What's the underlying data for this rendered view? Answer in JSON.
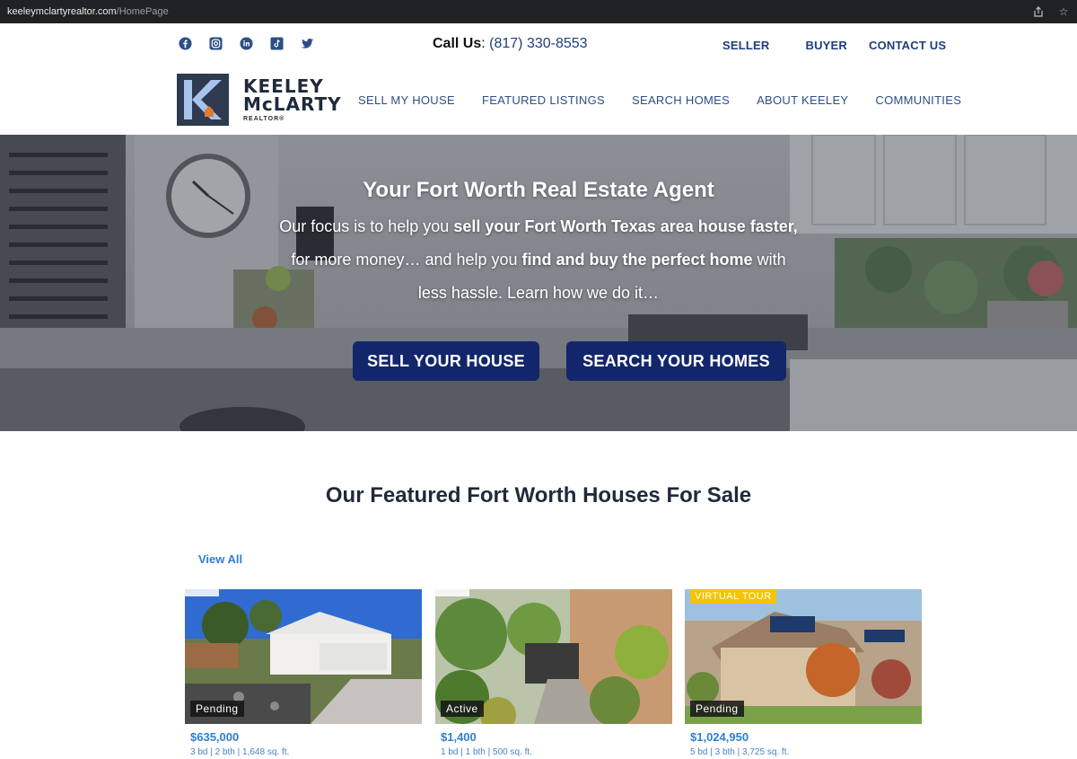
{
  "browser": {
    "domain": "keeleymclartyrealtor.com",
    "path": "/HomePage"
  },
  "topbar": {
    "socials": [
      "facebook-icon",
      "instagram-icon",
      "linkedin-icon",
      "tiktok-icon",
      "twitter-icon"
    ],
    "call_label": "Call Us",
    "call_sep": ":",
    "phone": "(817) 330-8553",
    "links": [
      "SELLER",
      "BUYER",
      "CONTACT US"
    ]
  },
  "logo": {
    "line1": "KEELEY",
    "line2": "McLARTY",
    "line3": "REALTOR®"
  },
  "nav": [
    "SELL MY HOUSE",
    "FEATURED LISTINGS",
    "SEARCH HOMES",
    "ABOUT KEELEY",
    "COMMUNITIES"
  ],
  "hero": {
    "title": "Your Fort Worth Real Estate Agent",
    "p1": "Our focus is to help you ",
    "b1": "sell your Fort Worth Texas area house faster,",
    "p2": " for more money… and help you ",
    "b2": "find and buy the perfect home",
    "p3": " with less hassle. Learn how we do it…",
    "btn_sell": "SELL YOUR HOUSE",
    "btn_search": "SEARCH YOUR HOMES"
  },
  "featured": {
    "title": "Our Featured Fort Worth Houses For Sale",
    "view_all": "View All",
    "listings": [
      {
        "status": "Pending",
        "price": "$635,000",
        "details": "3 bd | 2 bth | 1,648 sq. ft.",
        "tour": ""
      },
      {
        "status": "Active",
        "price": "$1,400",
        "details": "1 bd | 1 bth | 500 sq. ft.",
        "tour": ""
      },
      {
        "status": "Pending",
        "price": "$1,024,950",
        "details": "5 bd | 3 bth | 3,725 sq. ft.",
        "tour": "VIRTUAL TOUR"
      }
    ]
  },
  "colors": {
    "brand_navy": "#13266b",
    "link_blue": "#2f7fd1",
    "nav_blue": "#2c4f86",
    "tour_yellow": "#f4c400"
  }
}
